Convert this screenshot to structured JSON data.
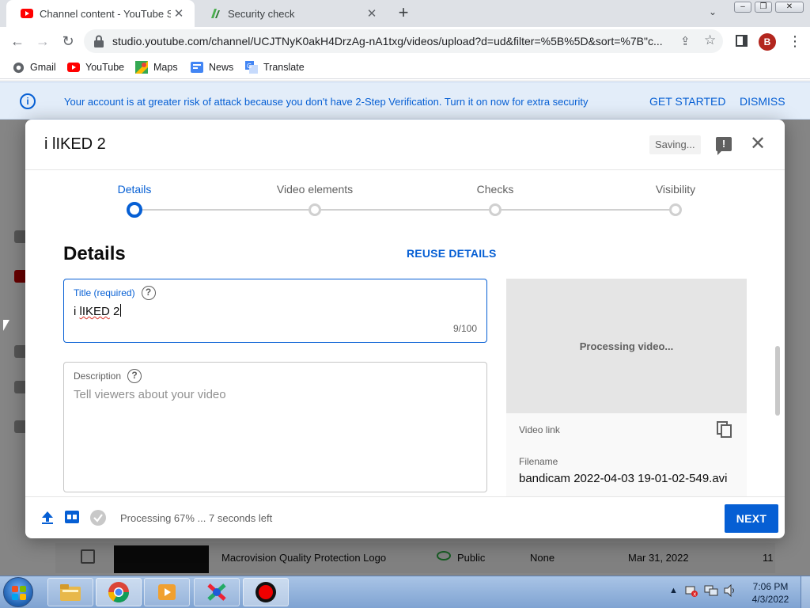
{
  "browser": {
    "tabs": [
      {
        "title": "Channel content - YouTube Studio",
        "active": true
      },
      {
        "title": "Security check",
        "active": false
      }
    ],
    "url": "studio.youtube.com/channel/UCJTNyK0akH4DrzAg-nA1txg/videos/upload?d=ud&filter=%5B%5D&sort=%7B\"c...",
    "profile_initial": "B",
    "bookmarks": [
      "Gmail",
      "YouTube",
      "Maps",
      "News",
      "Translate"
    ]
  },
  "banner": {
    "message": "Your account is at greater risk of attack because you don't have 2-Step Verification. Turn it on now for extra security",
    "get_started": "GET STARTED",
    "dismiss": "DISMISS"
  },
  "background_row": {
    "title": "Macrovision Quality Protection Logo",
    "visibility": "Public",
    "restrictions": "None",
    "date": "Mar 31, 2022",
    "views": "11"
  },
  "dialog": {
    "title": "i lIKED 2",
    "saving": "Saving...",
    "steps": [
      {
        "label": "Details",
        "active": true
      },
      {
        "label": "Video elements",
        "active": false
      },
      {
        "label": "Checks",
        "active": false
      },
      {
        "label": "Visibility",
        "active": false
      }
    ],
    "section_heading": "Details",
    "reuse_details": "REUSE DETAILS",
    "title_field": {
      "label": "Title (required)",
      "value_prefix": "i ",
      "value_misspelled": "lIKED",
      "value_suffix": " 2",
      "count": "9/100"
    },
    "description_field": {
      "label": "Description",
      "placeholder": "Tell viewers about your video"
    },
    "preview": {
      "processing": "Processing video...",
      "video_link_label": "Video link",
      "filename_label": "Filename",
      "filename": "bandicam 2022-04-03 19-01-02-549.avi"
    },
    "footer": {
      "status": "Processing 67% ... 7 seconds left",
      "next": "NEXT"
    }
  },
  "taskbar": {
    "time": "7:06 PM",
    "date": "4/3/2022"
  },
  "colors": {
    "accent": "#065fd4",
    "youtube_red": "#ff0000"
  }
}
